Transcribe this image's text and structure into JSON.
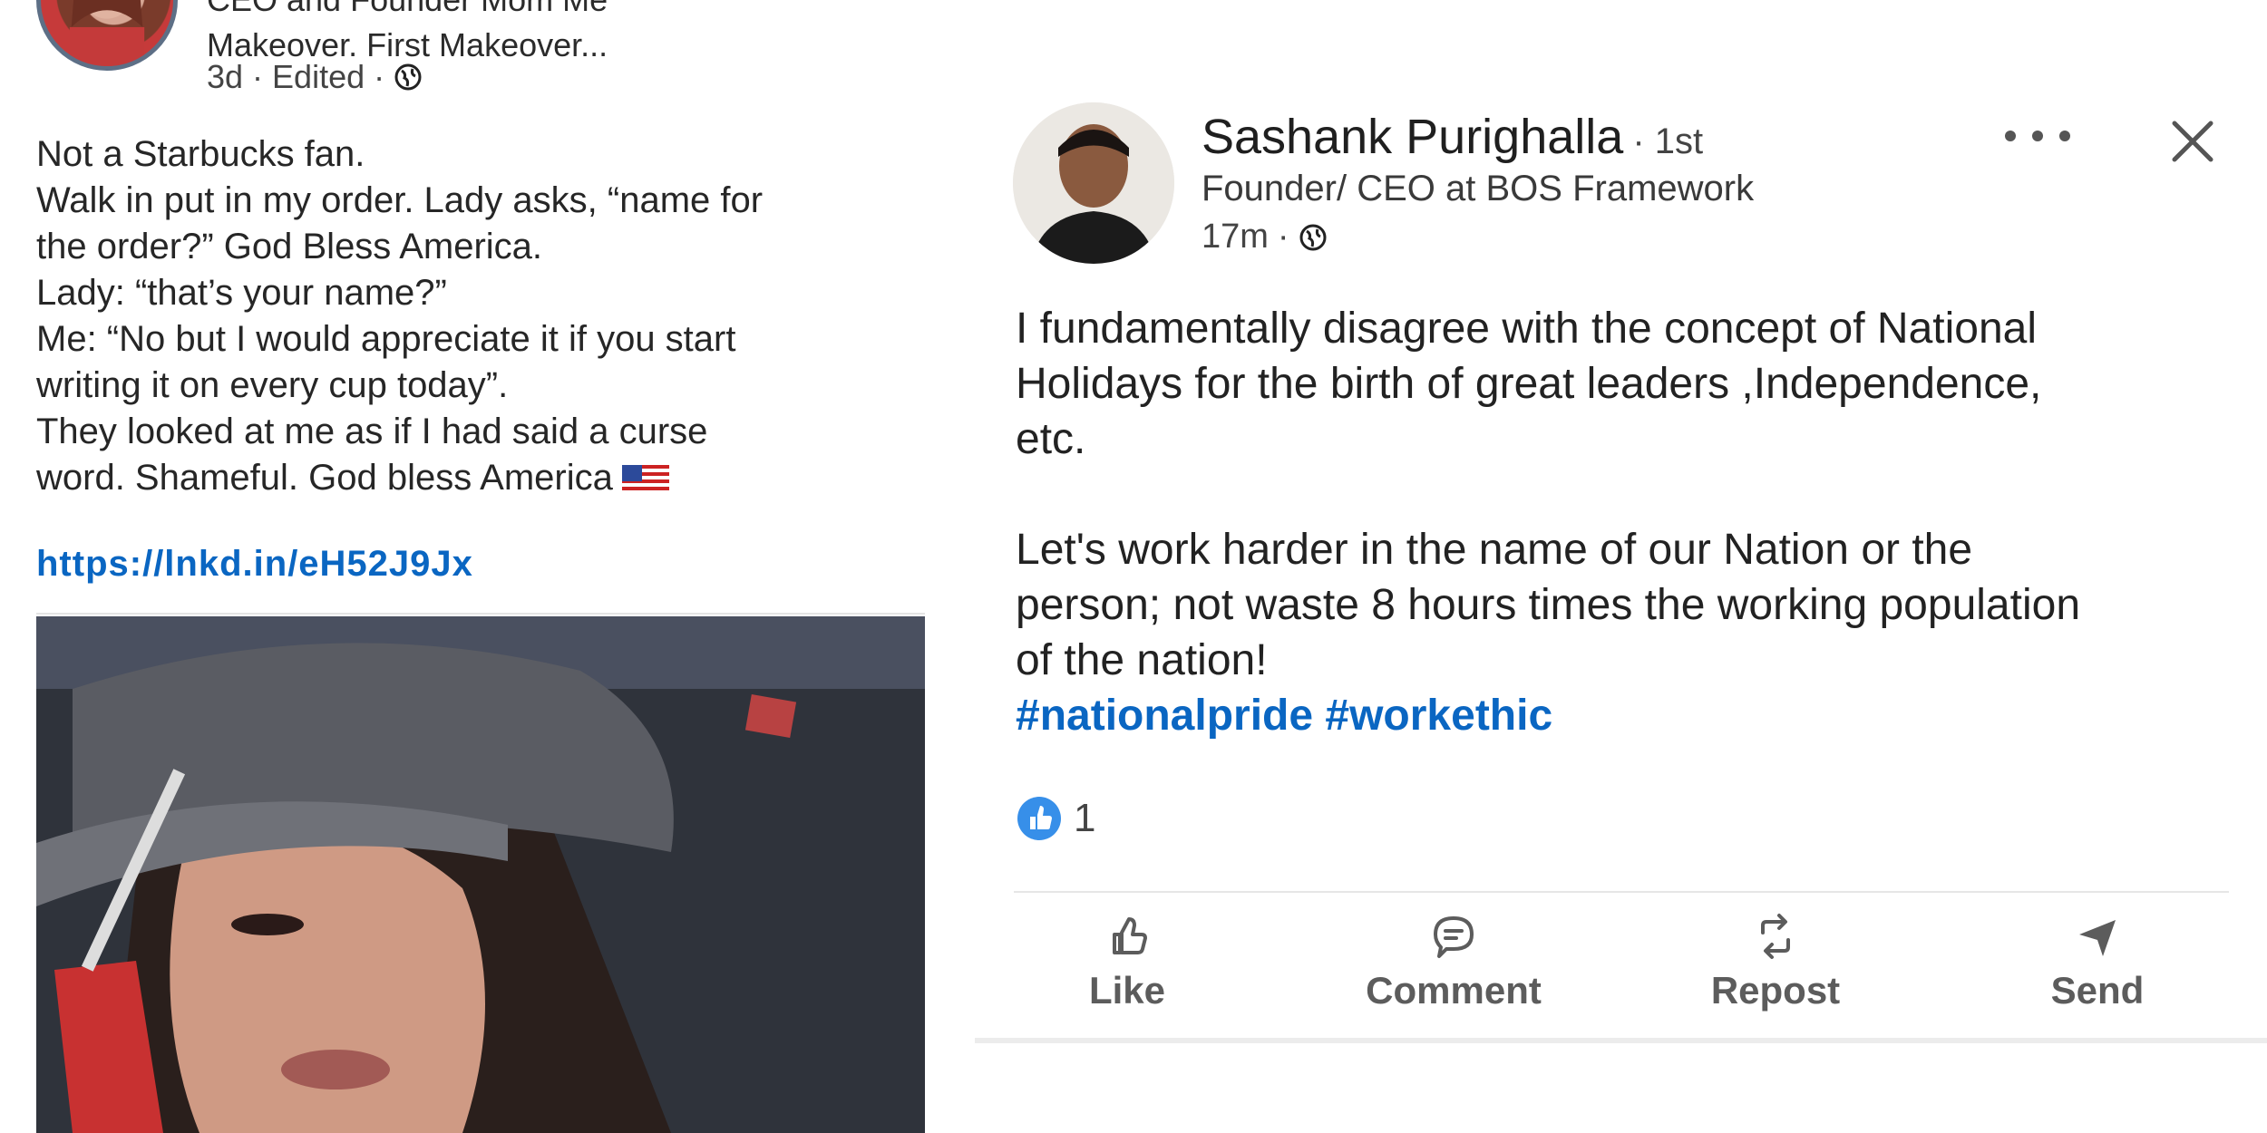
{
  "left_post": {
    "headline_line1": "CEO and Founder Mom Me",
    "headline_line2": "Makeover. First Makeover...",
    "time": "3d",
    "edited": "Edited",
    "body_lines": [
      "Not a Starbucks fan.",
      "Walk in put in my order. Lady asks, “name for",
      "the order?” God Bless America.",
      "Lady: “that’s your name?”",
      "Me: “No but I would appreciate it if you start",
      "writing it on every cup today”.",
      "They looked at me as if I had said a curse",
      "word. Shameful. God bless America"
    ],
    "link": "https://lnkd.in/eH52J9Jx",
    "photo_icon": "photo-woman-cap"
  },
  "right_post": {
    "name": "Sashank Purighalla",
    "degree": "· 1st",
    "headline": "Founder/ CEO at BOS Framework",
    "time": "17m",
    "body_p1": [
      "I fundamentally disagree with the concept of National",
      "Holidays for the birth of great leaders ,Independence,",
      "etc."
    ],
    "body_p2": [
      "Let's work harder in the name of our Nation or the",
      "person; not waste 8 hours times the working population",
      "of the nation!"
    ],
    "hashtags": "#nationalpride #workethic",
    "reaction_count": "1",
    "actions": {
      "like": "Like",
      "comment": "Comment",
      "repost": "Repost",
      "send": "Send"
    }
  },
  "colors": {
    "link_blue": "#0a66c2",
    "action_gray": "#5c5c5c"
  }
}
